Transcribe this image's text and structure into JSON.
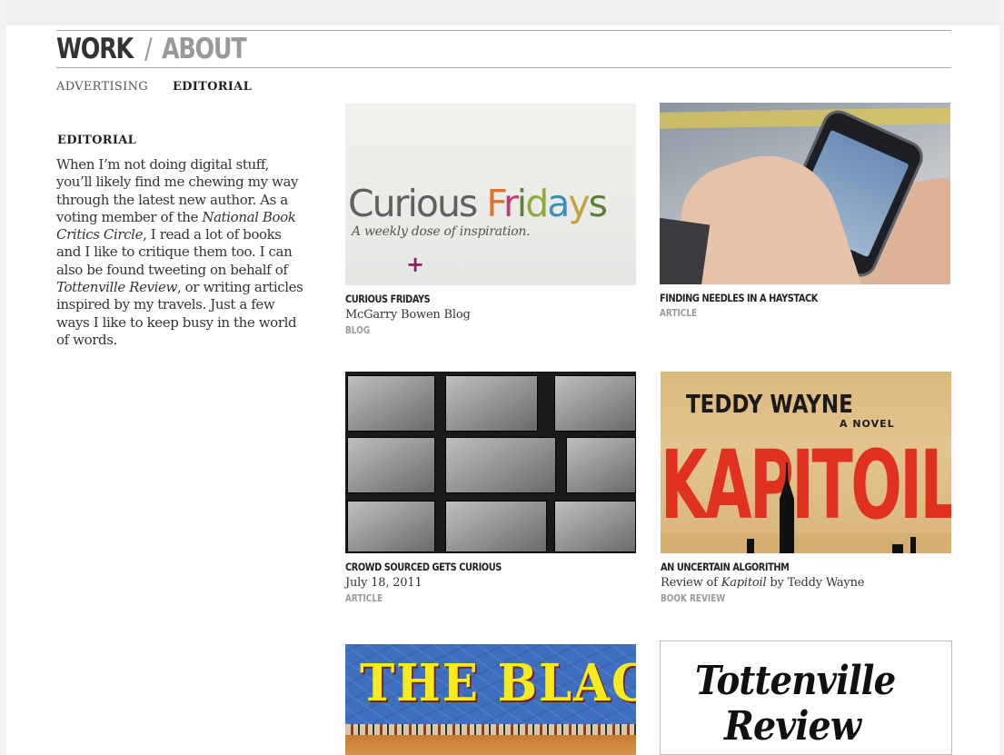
{
  "nav": {
    "work": "WORK",
    "separator": "/",
    "about": "ABOUT"
  },
  "subnav": {
    "advertising": "ADVERTISING",
    "editorial": "EDITORIAL"
  },
  "sidebar": {
    "heading": "EDITORIAL",
    "p1": "When I’m not doing digital stuff, you’ll likely find me chewing my way through the latest new author. As a voting member of the ",
    "em1": "National Book Critics Circle",
    "p2": ", I read a lot of books and I like to critique them too. I can also be found tweeting on behalf of ",
    "em2": "Tottenville Review",
    "p3": ", or writing articles inspired by my travels. Just a few ways I like to keep busy in the world of words."
  },
  "cards": [
    {
      "title": "CURIOUS FRIDAYS",
      "subtitle": "McGarry Bowen Blog",
      "category": "BLOG",
      "thumb": {
        "brand_a": "Curious ",
        "brand_f": "F",
        "brand_r": "r",
        "brand_i": "i",
        "brand_d": "d",
        "brand_a2": "a",
        "brand_y": "y",
        "brand_s": "s",
        "tagline": "A weekly dose of inspiration.",
        "plus": "+"
      }
    },
    {
      "title": "FINDING NEEDLES IN A HAYSTACK",
      "category": "ARTICLE"
    },
    {
      "title": "CROWD SOURCED GETS CURIOUS",
      "subtitle": "July 18, 2011",
      "category": "ARTICLE"
    },
    {
      "title": "AN UNCERTAIN ALGORITHM",
      "subtitle_pre": "Review of ",
      "subtitle_em": "Kapitoil",
      "subtitle_post": " by Teddy Wayne",
      "category": "BOOK REVIEW",
      "thumb": {
        "author": "TEDDY WAYNE",
        "novel": "A NOVEL",
        "title": "KAPITOIL"
      }
    },
    {
      "thumb": {
        "title": "THE BLACK"
      }
    },
    {
      "thumb": {
        "line1": "Tottenville",
        "line2": "Review"
      }
    }
  ],
  "colors": {
    "accent_plus": "#8e1b63",
    "kapitoil_red": "#e0301e",
    "black_yellow": "#f7ea1f",
    "black_blue": "#3d6ec0"
  }
}
